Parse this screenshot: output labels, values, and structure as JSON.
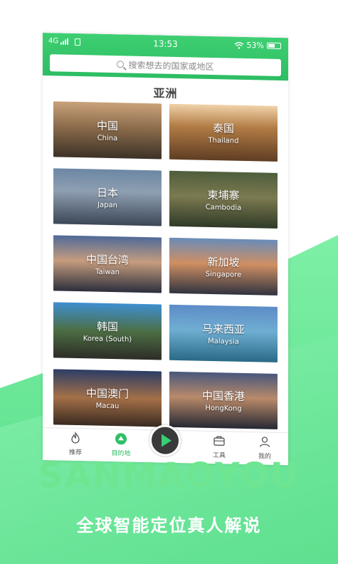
{
  "status": {
    "network": "4G",
    "time": "13:53",
    "battery": "53%"
  },
  "search": {
    "placeholder": "搜索想去的国家或地区"
  },
  "region": "亚洲",
  "destinations": [
    {
      "name": "中国",
      "en": "China"
    },
    {
      "name": "泰国",
      "en": "Thailand"
    },
    {
      "name": "日本",
      "en": "Japan"
    },
    {
      "name": "柬埔寨",
      "en": "Cambodia"
    },
    {
      "name": "中国台湾",
      "en": "Taiwan"
    },
    {
      "name": "新加坡",
      "en": "Singapore"
    },
    {
      "name": "韩国",
      "en": "Korea (South)"
    },
    {
      "name": "马来西亚",
      "en": "Malaysia"
    },
    {
      "name": "中国澳门",
      "en": "Macau"
    },
    {
      "name": "中国香港",
      "en": "HongKong"
    }
  ],
  "tabbar": {
    "recommend": "推荐",
    "destination": "目的地",
    "tools": "工具",
    "mine": "我的"
  },
  "brand": "SANMAOYOU",
  "slogan": "全球智能定位真人解说",
  "colors": {
    "accent": "#2fbf65",
    "promo_green": "#6fe592"
  },
  "icons": [
    "signal-icon",
    "sim-icon",
    "wifi-icon",
    "battery-icon",
    "search-icon",
    "recommend-icon",
    "destination-icon",
    "play-icon",
    "tools-icon",
    "user-icon"
  ]
}
